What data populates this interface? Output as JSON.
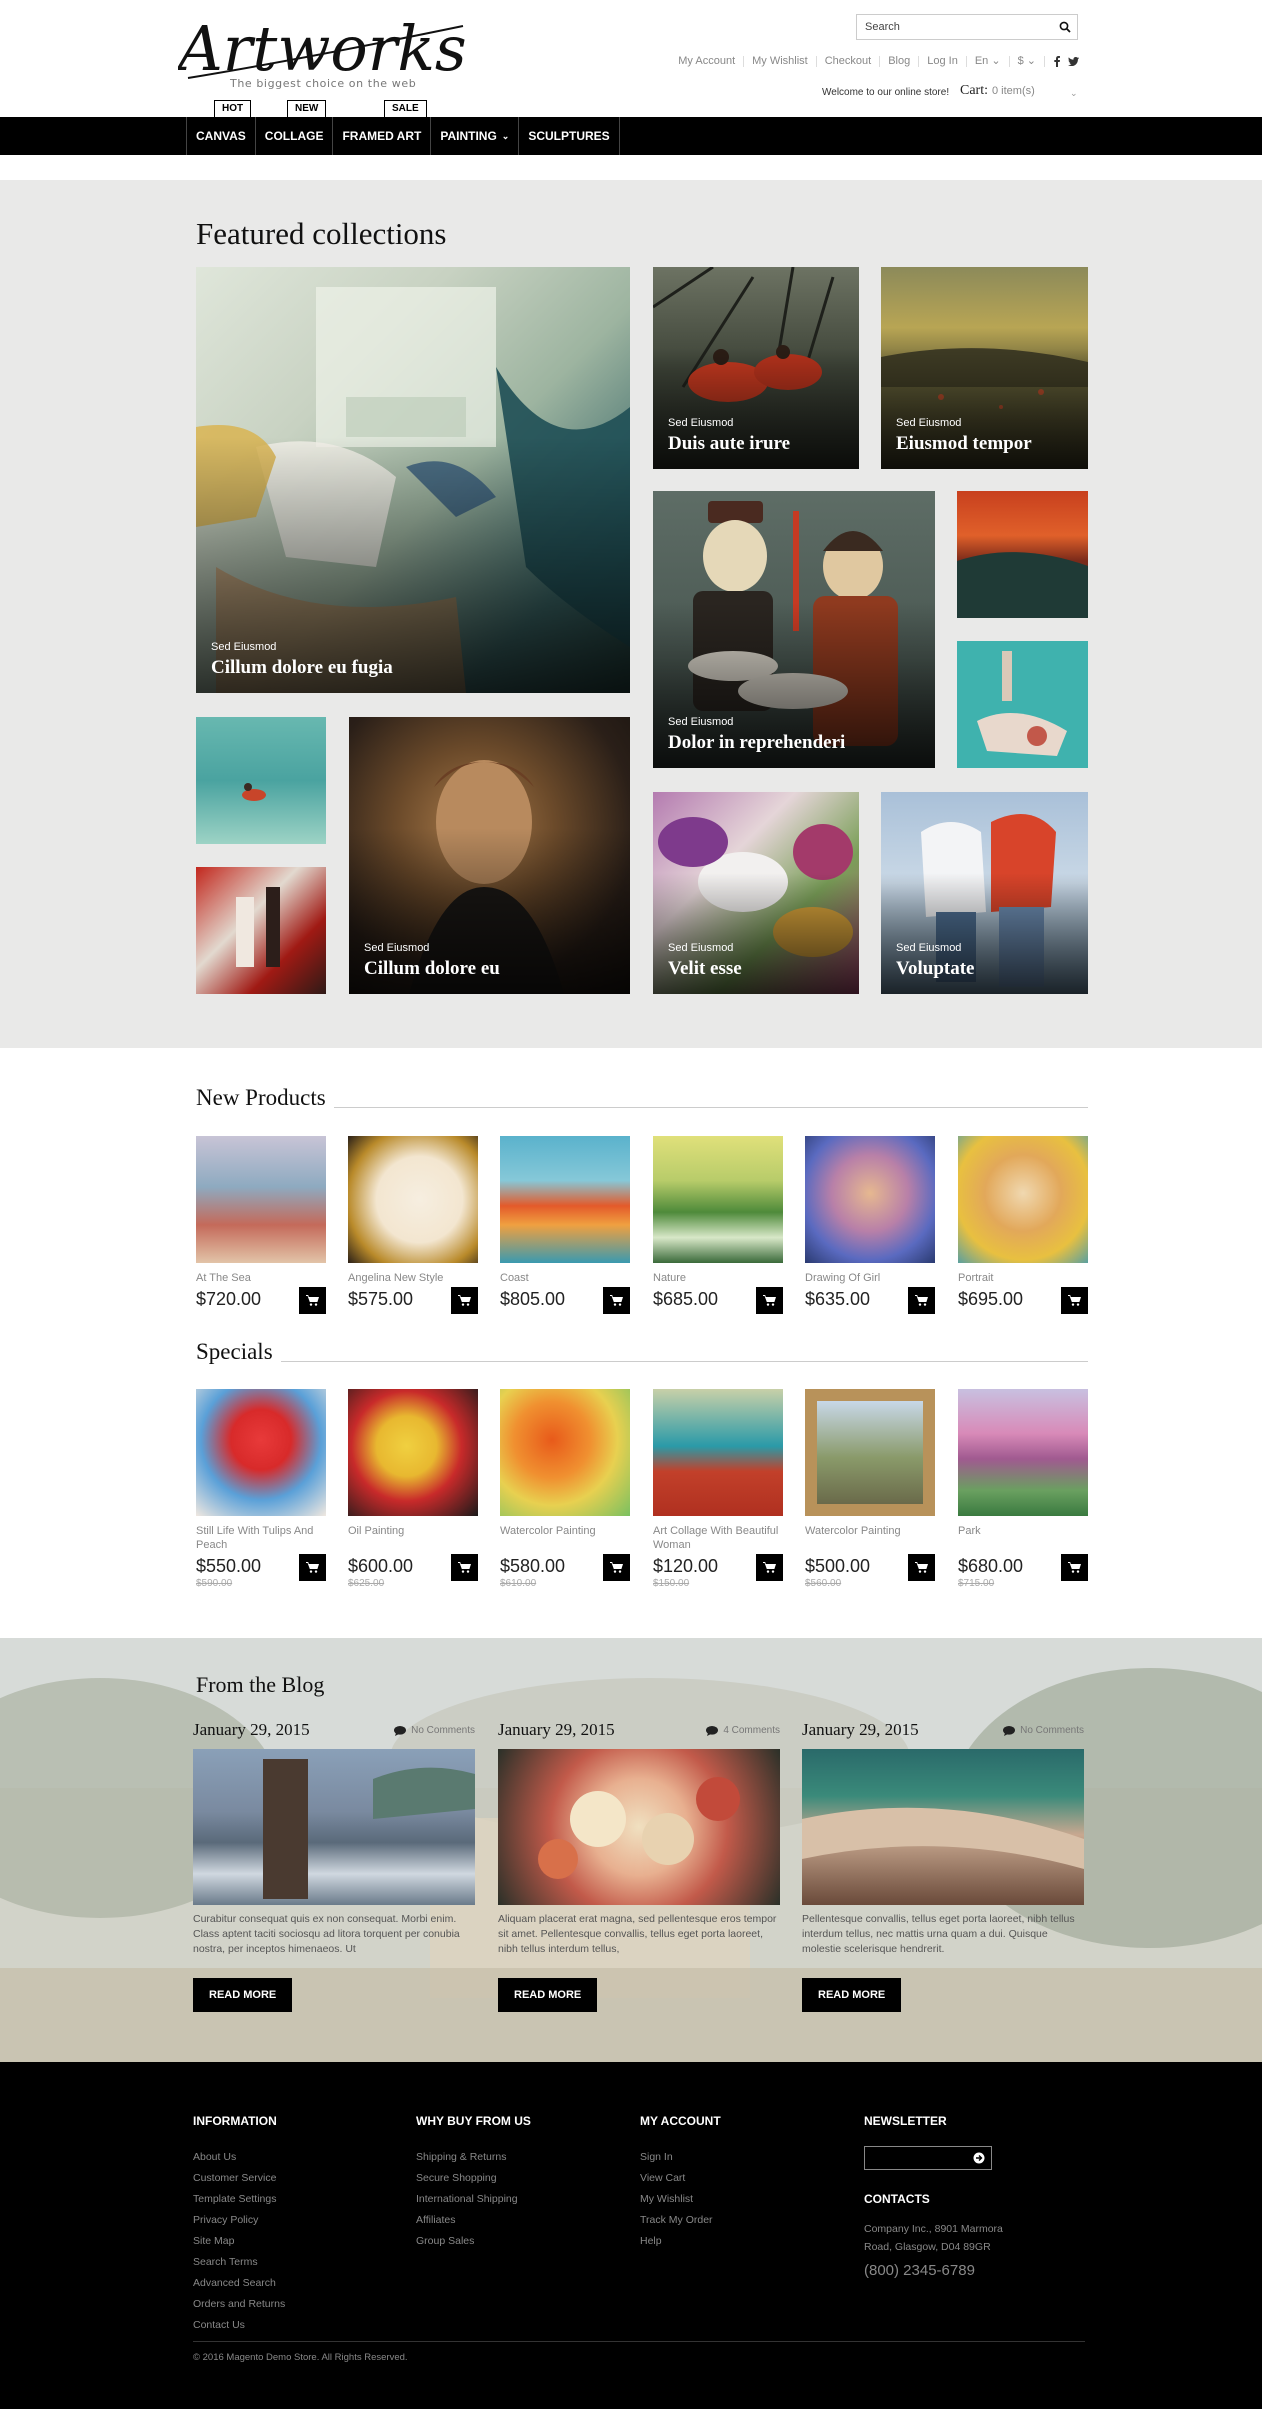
{
  "header": {
    "logo_text": "Artworks",
    "tagline": "The biggest choice on the web",
    "search_placeholder": "Search",
    "top_links": [
      "My Account",
      "My Wishlist",
      "Checkout",
      "Blog",
      "Log In",
      "En",
      "$"
    ],
    "welcome": "Welcome to our online store!",
    "cart_label": "Cart:",
    "cart_count": "0 item(s)"
  },
  "nav": {
    "items": [
      "CANVAS",
      "COLLAGE",
      "FRAMED ART",
      "PAINTING",
      "SCULPTURES"
    ],
    "badges": [
      "HOT",
      "NEW",
      "SALE"
    ]
  },
  "featured": {
    "title": "Featured collections",
    "tiles": [
      {
        "sub": "Sed Eiusmod",
        "title": "Cillum dolore eu fugia"
      },
      {
        "sub": "Sed Eiusmod",
        "title": "Duis aute irure"
      },
      {
        "sub": "Sed Eiusmod",
        "title": "Eiusmod tempor"
      },
      {
        "sub": "Sed Eiusmod",
        "title": "Dolor in reprehenderi"
      },
      {
        "sub": "Sed Eiusmod",
        "title": "Cillum dolore eu"
      },
      {
        "sub": "Sed Eiusmod",
        "title": "Velit esse"
      },
      {
        "sub": "Sed Eiusmod",
        "title": "Voluptate"
      }
    ]
  },
  "new_products": {
    "title": "New Products",
    "items": [
      {
        "name": "At The Sea",
        "price": "$720.00"
      },
      {
        "name": "Angelina New Style",
        "price": "$575.00"
      },
      {
        "name": "Coast",
        "price": "$805.00"
      },
      {
        "name": "Nature",
        "price": "$685.00"
      },
      {
        "name": "Drawing Of Girl",
        "price": "$635.00"
      },
      {
        "name": "Portrait",
        "price": "$695.00"
      }
    ]
  },
  "specials": {
    "title": "Specials",
    "items": [
      {
        "name": "Still Life With Tulips And Peach",
        "price": "$550.00",
        "old": "$590.00"
      },
      {
        "name": "Oil Painting",
        "price": "$600.00",
        "old": "$625.00"
      },
      {
        "name": "Watercolor Painting",
        "price": "$580.00",
        "old": "$610.00"
      },
      {
        "name": "Art Collage With Beautiful Woman",
        "price": "$120.00",
        "old": "$150.00"
      },
      {
        "name": "Watercolor Painting",
        "price": "$500.00",
        "old": "$560.00"
      },
      {
        "name": "Park",
        "price": "$680.00",
        "old": "$715.00"
      }
    ]
  },
  "blog": {
    "title": "From the Blog",
    "read_more": "READ MORE",
    "posts": [
      {
        "date": "January 29, 2015",
        "comments": "No Comments",
        "text": "Curabitur consequat quis ex non consequat. Morbi enim. Class aptent taciti sociosqu ad litora torquent per conubia nostra, per inceptos himenaeos. Ut"
      },
      {
        "date": "January 29, 2015",
        "comments": "4 Comments",
        "text": "Aliquam placerat erat magna, sed pellentesque eros tempor sit amet. Pellentesque convallis, tellus eget porta laoreet, nibh tellus interdum tellus,"
      },
      {
        "date": "January 29, 2015",
        "comments": "No Comments",
        "text": "Pellentesque convallis, tellus eget porta laoreet, nibh tellus interdum tellus, nec mattis urna quam a dui. Quisque molestie scelerisque hendrerit."
      }
    ]
  },
  "footer": {
    "information": {
      "title": "INFORMATION",
      "links": [
        "About Us",
        "Customer Service",
        "Template Settings",
        "Privacy Policy",
        "Site Map",
        "Search Terms",
        "Advanced Search",
        "Orders and Returns",
        "Contact Us"
      ]
    },
    "why_buy": {
      "title": "WHY BUY FROM US",
      "links": [
        "Shipping & Returns",
        "Secure Shopping",
        "International Shipping",
        "Affiliates",
        "Group Sales"
      ]
    },
    "account": {
      "title": "MY ACCOUNT",
      "links": [
        "Sign In",
        "View Cart",
        "My Wishlist",
        "Track My Order",
        "Help"
      ]
    },
    "newsletter": {
      "title": "NEWSLETTER"
    },
    "contacts": {
      "title": "CONTACTS",
      "address_line1": "Company Inc., 8901 Marmora",
      "address_line2": "Road, Glasgow, D04 89GR",
      "phone": "(800) 2345-6789"
    },
    "copyright": "© 2016 Magento Demo Store. All Rights Reserved."
  },
  "colors": {
    "accent": "#000000",
    "featured_bg": "#e9e9e8",
    "footer_bg": "#000000"
  }
}
